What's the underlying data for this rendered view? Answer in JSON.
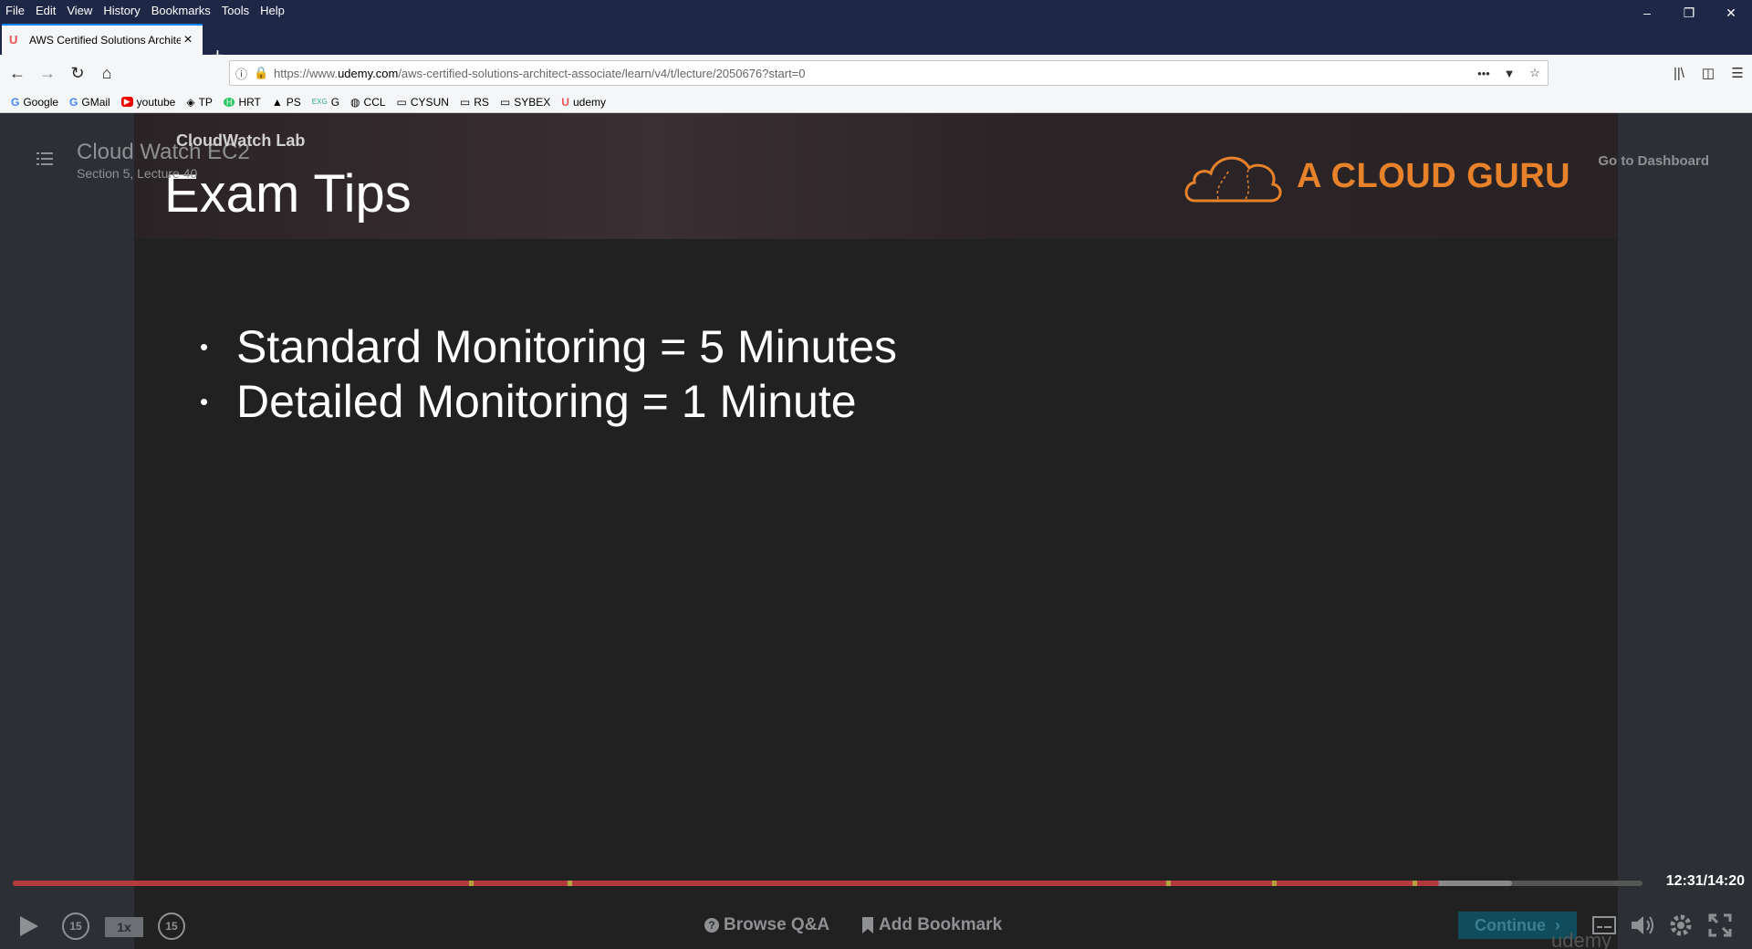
{
  "browser": {
    "menu": [
      "File",
      "Edit",
      "View",
      "History",
      "Bookmarks",
      "Tools",
      "Help"
    ],
    "tab": {
      "title": "AWS Certified Solutions Archite",
      "favicon": "U"
    },
    "url": {
      "prefix": "https://www.",
      "domain": "udemy.com",
      "path": "/aws-certified-solutions-architect-associate/learn/v4/t/lecture/2050676?start=0"
    },
    "bookmarks": [
      {
        "label": "Google",
        "icon": "G"
      },
      {
        "label": "GMail",
        "icon": "G"
      },
      {
        "label": "youtube",
        "icon": "▶"
      },
      {
        "label": "TP",
        "icon": "◈"
      },
      {
        "label": "HRT",
        "icon": "H"
      },
      {
        "label": "PS",
        "icon": "▲"
      },
      {
        "label": "G",
        "icon": "EXG"
      },
      {
        "label": "CCL",
        "icon": "◍"
      },
      {
        "label": "CYSUN",
        "icon": "▭"
      },
      {
        "label": "RS",
        "icon": "▭"
      },
      {
        "label": "SYBEX",
        "icon": "▭"
      },
      {
        "label": "udemy",
        "icon": "U"
      }
    ]
  },
  "player": {
    "lecture_title": "Cloud Watch EC2",
    "lecture_subtitle": "Section 5, Lecture 40",
    "slide_tag": "CloudWatch Lab",
    "dashboard_link": "Go to Dashboard",
    "slide": {
      "title": "Exam Tips",
      "brand": "A CLOUD GURU",
      "bullets": [
        "Standard Monitoring = 5 Minutes",
        "Detailed Monitoring = 1 Minute"
      ]
    },
    "timecode": "12:31/14:20",
    "progress_watched_fraction": 0.875,
    "progress_buffered_fraction": 0.92,
    "speed": "1x",
    "rewind_label": "15",
    "forward_label": "15",
    "browse_qa": "Browse Q&A",
    "add_bookmark": "Add Bookmark",
    "continue": "Continue",
    "watermark": "udemy",
    "colors": {
      "progress": "#b33a3a",
      "brand": "#e8822a",
      "continue_bg": "#0f4c5c"
    }
  }
}
